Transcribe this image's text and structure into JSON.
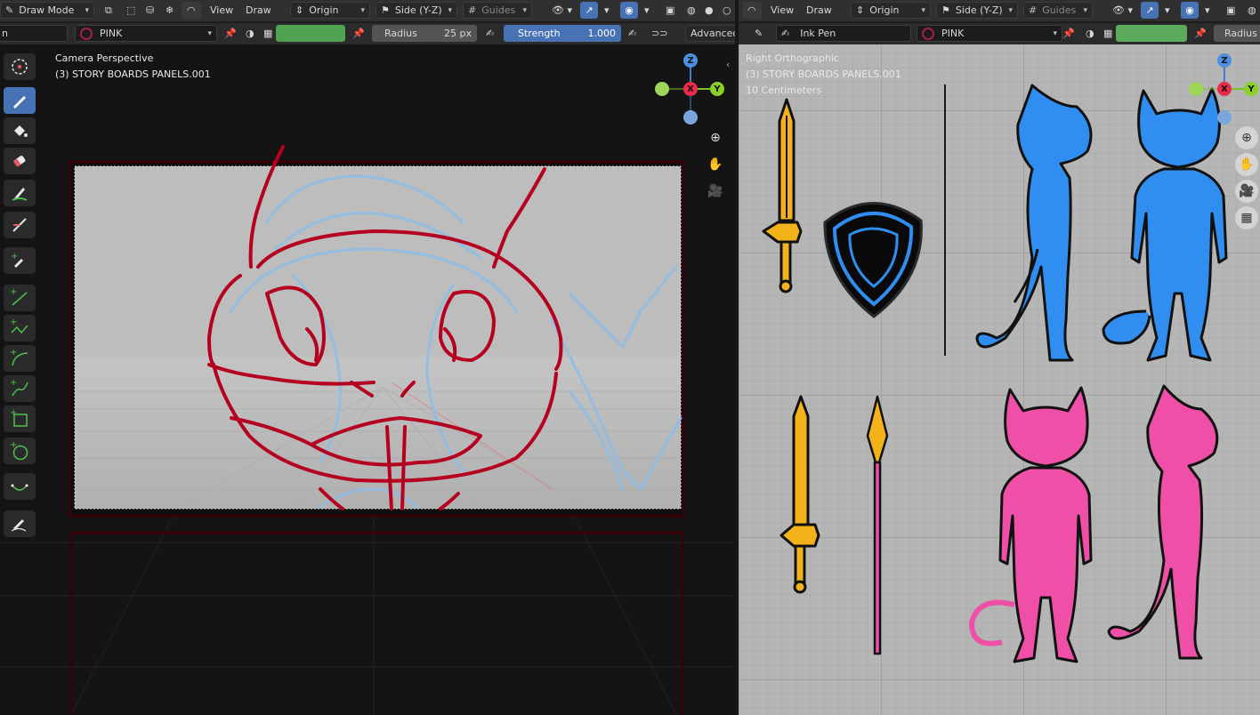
{
  "left_header": {
    "mode_label": "Draw Mode",
    "menu_view": "View",
    "menu_draw": "Draw",
    "pivot_label": "Origin",
    "axis_label": "Side (Y-Z)",
    "guides_label": "Guides"
  },
  "left_tool_settings": {
    "material_name": "PINK",
    "radius_label": "Radius",
    "radius_value": "25 px",
    "strength_label": "Strength",
    "strength_value": "1.000",
    "advanced_label": "Advanced",
    "color_swatch": "#4fa24f"
  },
  "left_viewport": {
    "view_name": "Camera Perspective",
    "object_name": "(3) STORY BOARDS PANELS.001"
  },
  "right_header": {
    "menu_view": "View",
    "menu_draw": "Draw",
    "pivot_label": "Origin",
    "axis_label": "Side (Y-Z)",
    "guides_label": "Guides"
  },
  "right_tool_settings": {
    "brush_name": "Ink Pen",
    "material_name": "PINK",
    "radius_label": "Radius",
    "color_swatch": "#5cab5c"
  },
  "right_viewport": {
    "view_name": "Right Orthographic",
    "object_name": "(3) STORY BOARDS PANELS.001",
    "scale_label": "10 Centimeters"
  },
  "gizmo": {
    "z": "Z",
    "x": "X",
    "y": "Y"
  },
  "colors": {
    "sketch_red": "#b5001f",
    "sketch_blue": "#8fbde6",
    "cat_blue": "#2f8ef0",
    "cat_pink": "#f04fa8",
    "gold": "#f4b21a",
    "ui_blue": "#4772b3"
  },
  "tools": [
    {
      "name": "cursor-tool"
    },
    {
      "name": "draw-tool"
    },
    {
      "name": "fill-tool"
    },
    {
      "name": "erase-tool"
    },
    {
      "name": "tint-tool"
    },
    {
      "name": "cutter-tool"
    },
    {
      "name": "eyedropper-tool"
    },
    {
      "name": "line-tool"
    },
    {
      "name": "polyline-tool"
    },
    {
      "name": "arc-tool"
    },
    {
      "name": "curve-tool"
    },
    {
      "name": "box-tool"
    },
    {
      "name": "circle-tool"
    },
    {
      "name": "interpolate-tool"
    },
    {
      "name": "annotate-tool"
    }
  ]
}
